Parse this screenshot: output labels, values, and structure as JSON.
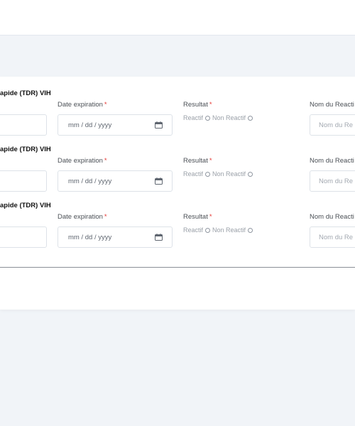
{
  "section_title": "apide (TDR) VIH",
  "labels": {
    "date_expiration": "Date expiration",
    "resultat": "Resultat",
    "nom_reactif": "Nom du Reacti",
    "required_mark": "*"
  },
  "date_placeholder": "mm / dd / yyyy",
  "radio_options": {
    "reactif": "Reactif",
    "non_reactif": "Non Reactif"
  },
  "nom_placeholder": "Nom du Re",
  "rows": [
    {
      "section_title": "apide (TDR) VIH"
    },
    {
      "section_title": "apide (TDR) VIH"
    },
    {
      "section_title": "apide (TDR) VIH"
    }
  ]
}
